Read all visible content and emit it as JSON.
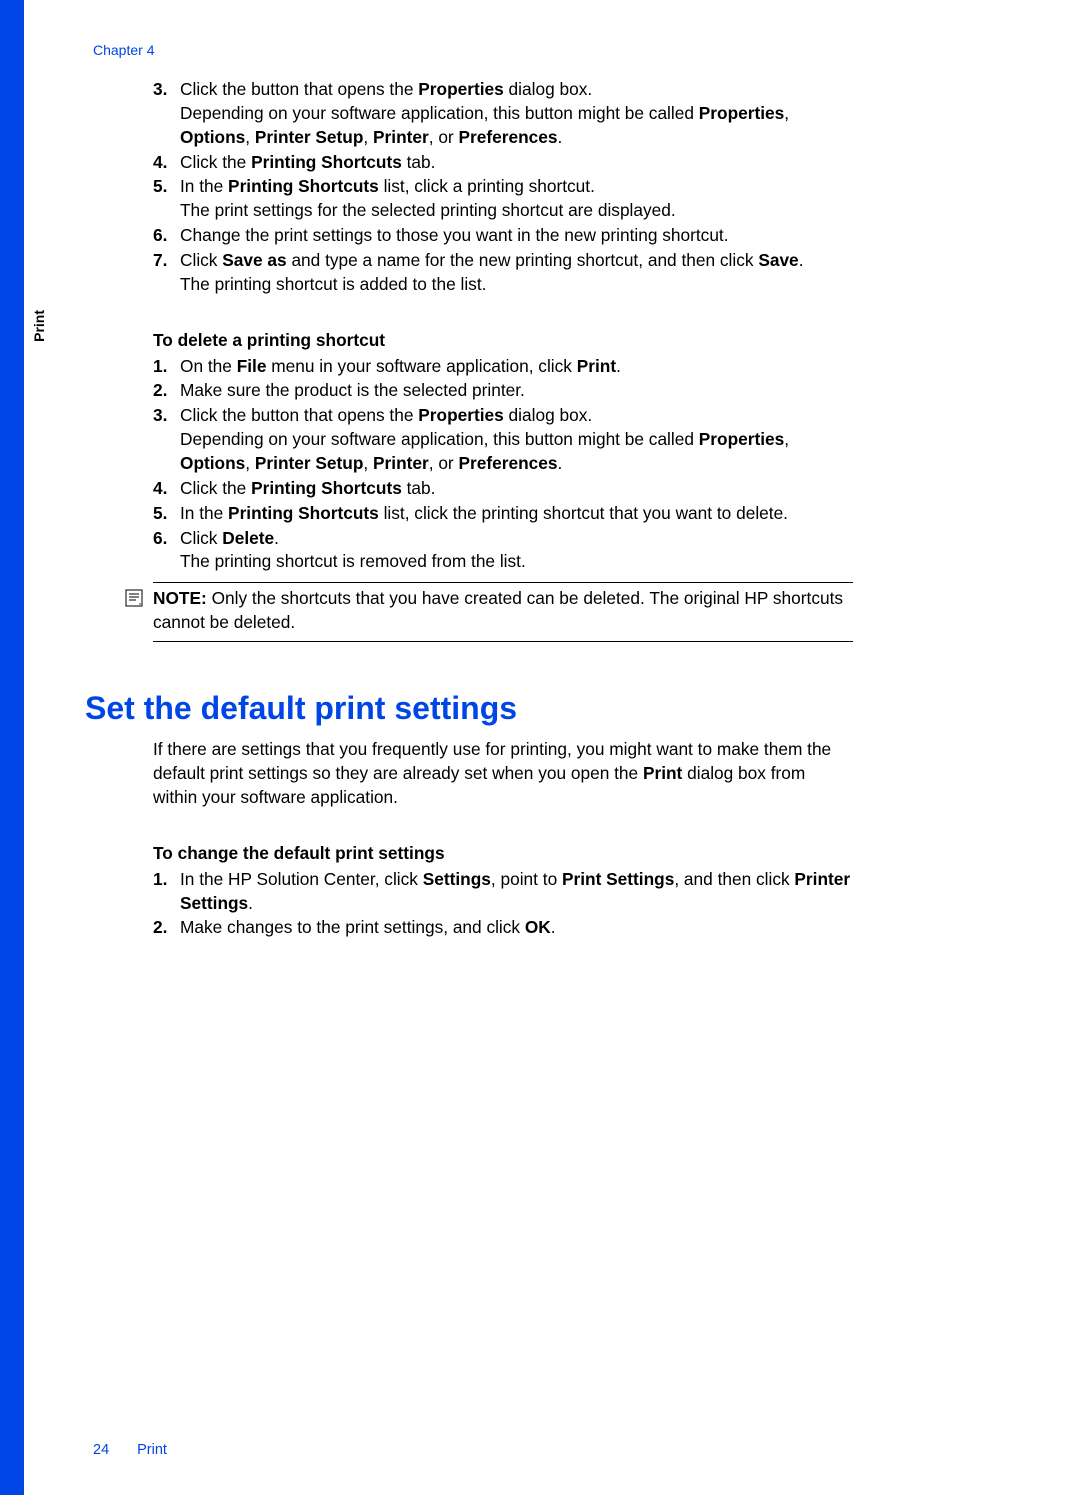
{
  "header": {
    "chapter": "Chapter 4"
  },
  "sideTab": "Print",
  "list1": {
    "i3a": "Click the button that opens the ",
    "i3b": "Properties",
    "i3c": " dialog box.",
    "i3d": "Depending on your software application, this button might be called ",
    "i3e": "Properties",
    "i3f": ", ",
    "i3g": "Options",
    "i3h": ", ",
    "i3i": "Printer Setup",
    "i3j": ", ",
    "i3k": "Printer",
    "i3l": ", or ",
    "i3m": "Preferences",
    "i3n": ".",
    "i4a": "Click the ",
    "i4b": "Printing Shortcuts",
    "i4c": " tab.",
    "i5a": "In the ",
    "i5b": "Printing Shortcuts",
    "i5c": " list, click a printing shortcut.",
    "i5d": "The print settings for the selected printing shortcut are displayed.",
    "i6": "Change the print settings to those you want in the new printing shortcut.",
    "i7a": "Click ",
    "i7b": "Save as",
    "i7c": " and type a name for the new printing shortcut, and then click ",
    "i7d": "Save",
    "i7e": ".",
    "i7f": "The printing shortcut is added to the list."
  },
  "subhead1": "To delete a printing shortcut",
  "list2": {
    "i1a": "On the ",
    "i1b": "File",
    "i1c": " menu in your software application, click ",
    "i1d": "Print",
    "i1e": ".",
    "i2": "Make sure the product is the selected printer.",
    "i3a": "Click the button that opens the ",
    "i3b": "Properties",
    "i3c": " dialog box.",
    "i3d": "Depending on your software application, this button might be called ",
    "i3e": "Properties",
    "i3f": ", ",
    "i3g": "Options",
    "i3h": ", ",
    "i3i": "Printer Setup",
    "i3j": ", ",
    "i3k": "Printer",
    "i3l": ", or ",
    "i3m": "Preferences",
    "i3n": ".",
    "i4a": "Click the ",
    "i4b": "Printing Shortcuts",
    "i4c": " tab.",
    "i5a": "In the ",
    "i5b": "Printing Shortcuts",
    "i5c": " list, click the printing shortcut that you want to delete.",
    "i6a": "Click ",
    "i6b": "Delete",
    "i6c": ".",
    "i6d": "The printing shortcut is removed from the list."
  },
  "note": {
    "label": "NOTE:",
    "text": "  Only the shortcuts that you have created can be deleted. The original HP shortcuts cannot be deleted."
  },
  "h1": "Set the default print settings",
  "intro": {
    "a": "If there are settings that you frequently use for printing, you might want to make them the default print settings so they are already set when you open the ",
    "b": "Print",
    "c": " dialog box from within your software application."
  },
  "subhead2": "To change the default print settings",
  "list3": {
    "i1a": "In the HP Solution Center, click ",
    "i1b": "Settings",
    "i1c": ", point to ",
    "i1d": "Print Settings",
    "i1e": ", and then click ",
    "i1f": "Printer Settings",
    "i1g": ".",
    "i2a": "Make changes to the print settings, and click ",
    "i2b": "OK",
    "i2c": "."
  },
  "footer": {
    "page": "24",
    "title": "Print"
  }
}
